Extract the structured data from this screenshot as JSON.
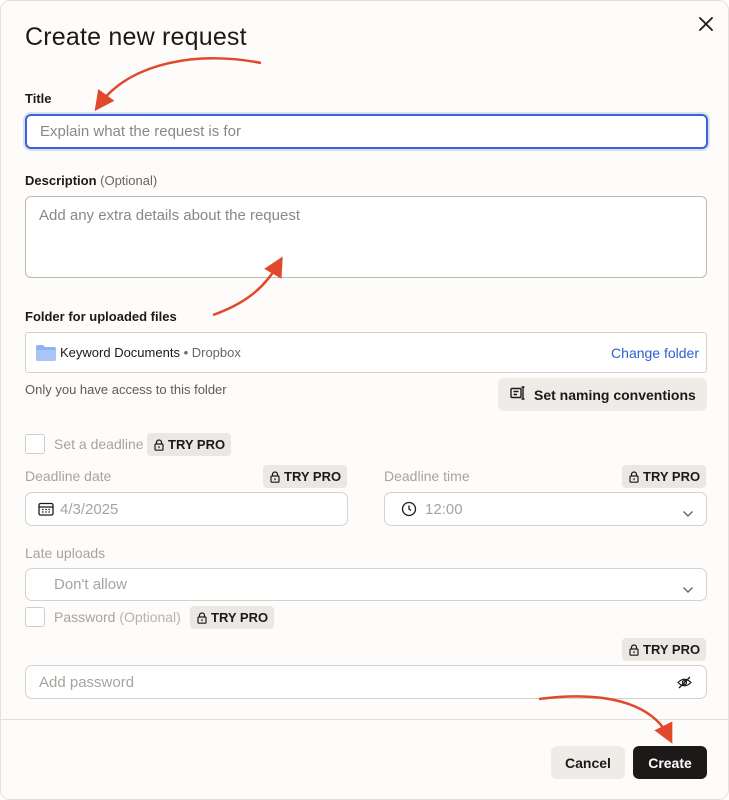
{
  "dialog": {
    "title": "Create new request",
    "close_icon": "close-icon"
  },
  "title_field": {
    "label": "Title",
    "placeholder": "Explain what the request is for"
  },
  "description_field": {
    "label": "Description",
    "optional": "(Optional)",
    "placeholder": "Add any extra details about the request"
  },
  "folder": {
    "label": "Folder for uploaded files",
    "name": "Keyword Documents",
    "separator": " • ",
    "source": "Dropbox",
    "change_label": "Change folder",
    "access_note": "Only you have access to this folder",
    "naming_button": "Set naming conventions"
  },
  "deadline": {
    "checkbox_label": "Set a deadline",
    "date_label": "Deadline date",
    "date_value": "4/3/2025",
    "time_label": "Deadline time",
    "time_value": "12:00"
  },
  "late_uploads": {
    "label": "Late uploads",
    "value": "Don't allow"
  },
  "password": {
    "label": "Password",
    "optional": "(Optional)",
    "placeholder": "Add password"
  },
  "badges": {
    "try_pro": "TRY PRO"
  },
  "footer": {
    "cancel": "Cancel",
    "create": "Create"
  },
  "colors": {
    "accent": "#3a64d6",
    "link": "#2f5fd0",
    "primary_button": "#1e1919",
    "annotation_arrow": "#e2492b"
  }
}
